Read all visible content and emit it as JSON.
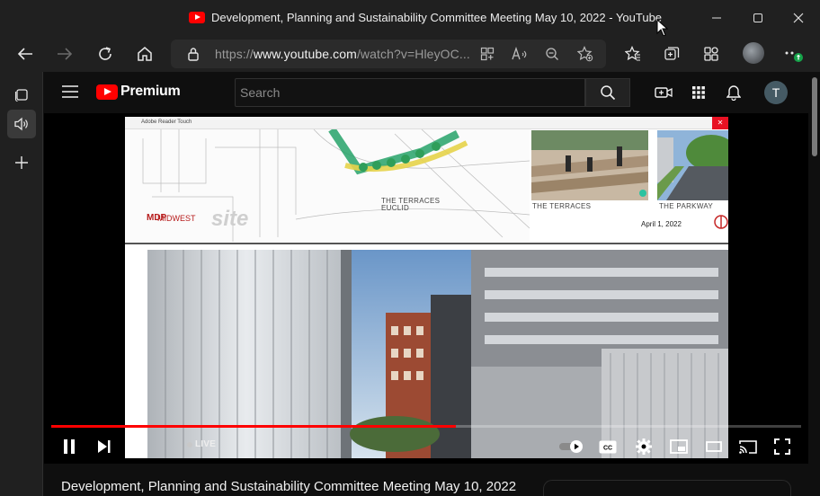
{
  "window": {
    "title": "Development, Planning and Sustainability Committee Meeting May 10, 2022 - YouTube"
  },
  "address_bar": {
    "scheme": "https://",
    "host": "www.youtube.com",
    "path": "/watch?v=HleyOC..."
  },
  "youtube": {
    "brand": "Premium",
    "search_placeholder": "Search",
    "avatar_initial": "T"
  },
  "slide": {
    "app_name": "Adobe Reader Touch",
    "captions": {
      "terraces_euclid": "THE TERRACES\nEUCLID",
      "terraces": "THE TERRACES",
      "parkway": "THE PARKWAY"
    },
    "brand": {
      "mark": "MDP",
      "name": "MIDWEST",
      "site": "site"
    },
    "date": "April 1, 2022"
  },
  "player": {
    "live_label": "LIVE",
    "progress_fraction": 0.54
  },
  "video": {
    "title": "Development, Planning and Sustainability Committee Meeting May 10, 2022"
  },
  "icons": {
    "title": [
      "youtube-icon",
      "minimize-icon",
      "maximize-icon",
      "close-icon"
    ],
    "nav": [
      "back-icon",
      "forward-icon",
      "refresh-icon",
      "home-icon",
      "lock-icon",
      "app-available-icon",
      "read-aloud-icon",
      "zoom-out-icon",
      "add-favorite-icon",
      "favorites-icon",
      "collections-icon",
      "extensions-icon",
      "more-icon"
    ],
    "player": [
      "pause-icon",
      "next-icon",
      "volume-icon",
      "autoplay-toggle",
      "captions-icon",
      "settings-icon",
      "miniplayer-icon",
      "theater-icon",
      "cast-icon",
      "fullscreen-icon"
    ]
  },
  "colors": {
    "youtube_red": "#ff0000",
    "page_bg": "#0f0f0f",
    "chrome_bg": "#202020"
  }
}
